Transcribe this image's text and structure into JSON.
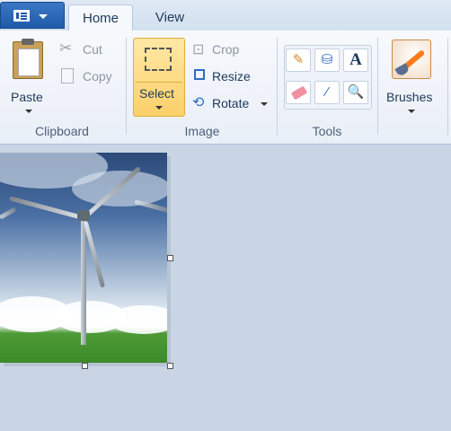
{
  "tabs": {
    "home": "Home",
    "view": "View"
  },
  "clipboard": {
    "paste": "Paste",
    "cut": "Cut",
    "copy": "Copy",
    "group_label": "Clipboard"
  },
  "image": {
    "select": "Select",
    "crop": "Crop",
    "resize": "Resize",
    "rotate": "Rotate",
    "group_label": "Image"
  },
  "tools": {
    "group_label": "Tools",
    "items": [
      "pencil-icon",
      "fill-bucket-icon",
      "text-icon",
      "eraser-icon",
      "color-picker-icon",
      "magnifier-icon"
    ],
    "text_glyph": "A"
  },
  "brushes": {
    "label": "Brushes"
  },
  "colors": {
    "select_highlight": "#fbd06a",
    "file_button": "#1f5aa8",
    "canvas_bg": "#c9d5e4"
  }
}
